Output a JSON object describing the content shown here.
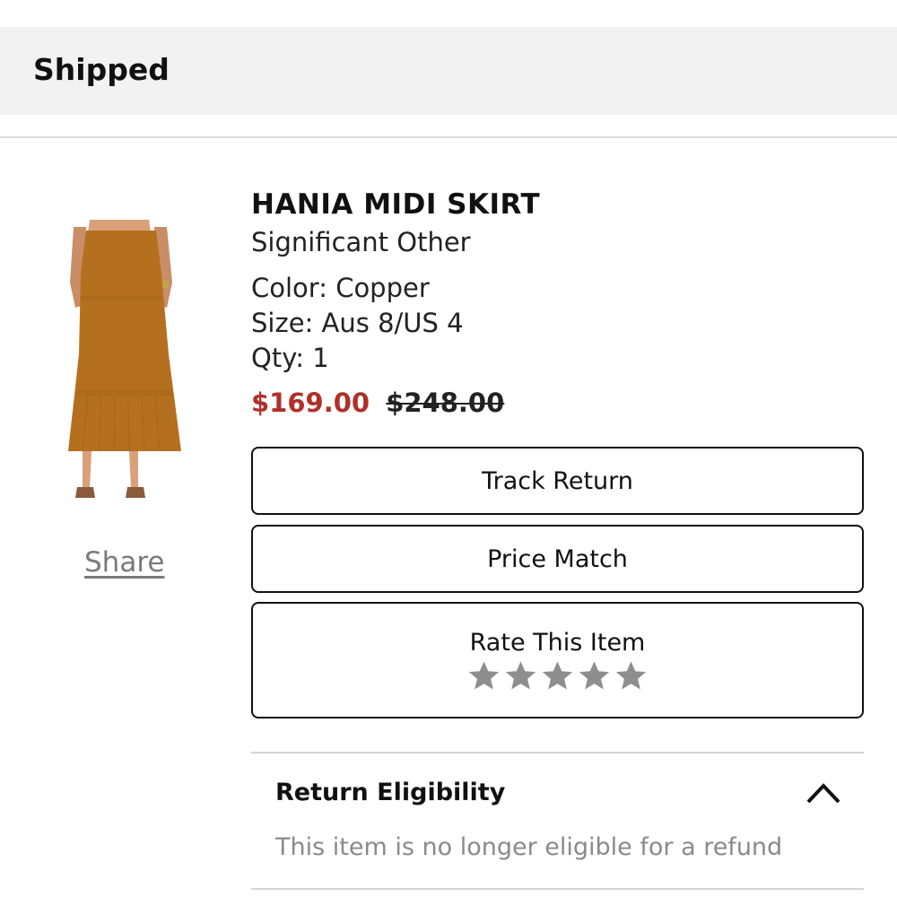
{
  "status": {
    "title": "Shipped"
  },
  "product": {
    "name": "HANIA MIDI SKIRT",
    "brand": "Significant Other",
    "color": "Color: Copper",
    "size": "Size: Aus 8/US 4",
    "qty": "Qty: 1",
    "sale_price": "$169.00",
    "original_price": "$248.00",
    "image": {
      "icon": "skirt-product-photo",
      "color": "#b5701f"
    }
  },
  "share": {
    "label": "Share"
  },
  "actions": {
    "track_return": "Track Return",
    "price_match": "Price Match",
    "rate_label": "Rate This Item",
    "rating": 0,
    "max_rating": 5
  },
  "eligibility": {
    "title": "Return Eligibility",
    "message": "This item is no longer eligible for a refund",
    "expanded": true
  },
  "colors": {
    "sale": "#b0302a",
    "star_empty": "#8e8e8e",
    "header_bg": "#f2f2f2"
  }
}
